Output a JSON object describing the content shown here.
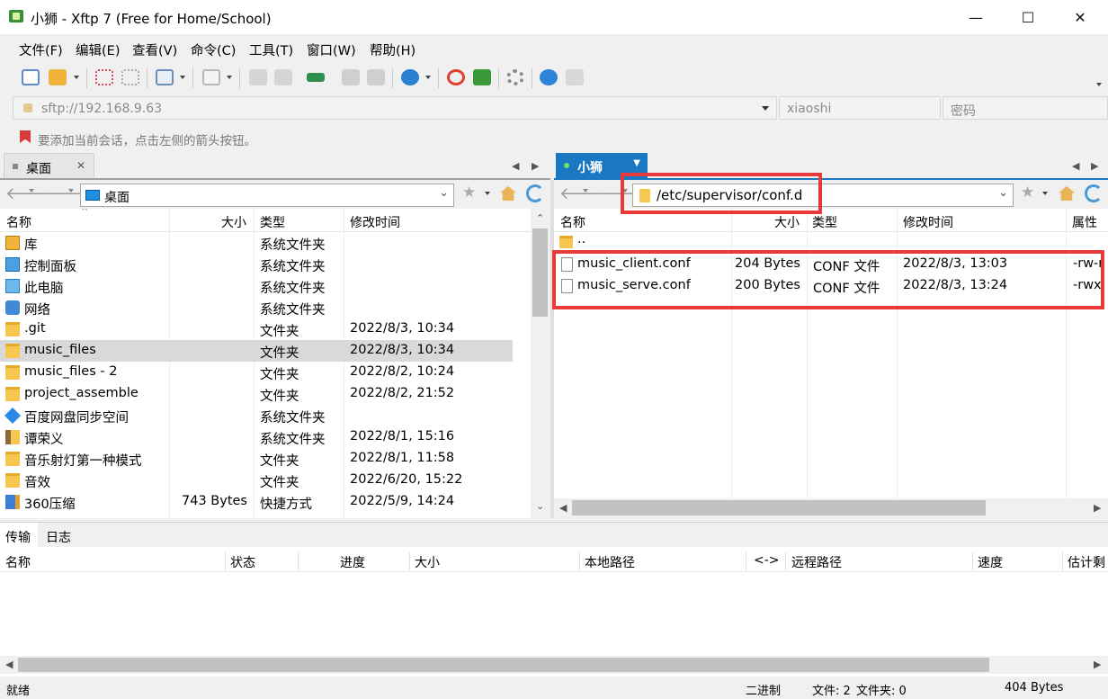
{
  "window": {
    "title": "小狮 - Xftp 7 (Free for Home/School)",
    "min_glyph": "—",
    "max_glyph": "☐",
    "close_glyph": "✕"
  },
  "menu": [
    "文件(F)",
    "编辑(E)",
    "查看(V)",
    "命令(C)",
    "工具(T)",
    "窗口(W)",
    "帮助(H)"
  ],
  "address": {
    "url": "sftp://192.168.9.63",
    "username": "xiaoshi",
    "password_placeholder": "密码"
  },
  "hint": "要添加当前会话，点击左侧的箭头按钮。",
  "left_pane": {
    "tab_label": "桌面",
    "path": "桌面",
    "columns": [
      "名称",
      "大小",
      "类型",
      "修改时间"
    ],
    "rows": [
      {
        "name": "库",
        "size": "",
        "type": "系统文件夹",
        "modified": "",
        "icon": "library-icon"
      },
      {
        "name": "控制面板",
        "size": "",
        "type": "系统文件夹",
        "modified": "",
        "icon": "control-panel-icon"
      },
      {
        "name": "此电脑",
        "size": "",
        "type": "系统文件夹",
        "modified": "",
        "icon": "computer-icon"
      },
      {
        "name": "网络",
        "size": "",
        "type": "系统文件夹",
        "modified": "",
        "icon": "network-icon"
      },
      {
        "name": ".git",
        "size": "",
        "type": "文件夹",
        "modified": "2022/8/3, 10:34",
        "icon": "folder-icon"
      },
      {
        "name": "music_files",
        "size": "",
        "type": "文件夹",
        "modified": "2022/8/3, 10:34",
        "icon": "folder-icon",
        "selected": true
      },
      {
        "name": "music_files - 2",
        "size": "",
        "type": "文件夹",
        "modified": "2022/8/2, 10:24",
        "icon": "folder-icon"
      },
      {
        "name": "project_assemble",
        "size": "",
        "type": "文件夹",
        "modified": "2022/8/2, 21:52",
        "icon": "folder-icon"
      },
      {
        "name": "百度网盘同步空间",
        "size": "",
        "type": "系统文件夹",
        "modified": "",
        "icon": "baidu-sync-icon"
      },
      {
        "name": "谭荣义",
        "size": "",
        "type": "系统文件夹",
        "modified": "2022/8/1, 15:16",
        "icon": "user-folder-icon"
      },
      {
        "name": "音乐射灯第一种模式",
        "size": "",
        "type": "文件夹",
        "modified": "2022/8/1, 11:58",
        "icon": "folder-icon"
      },
      {
        "name": "音效",
        "size": "",
        "type": "文件夹",
        "modified": "2022/6/20, 15:22",
        "icon": "folder-icon"
      },
      {
        "name": "360压缩",
        "size": "743 Bytes",
        "type": "快捷方式",
        "modified": "2022/5/9, 14:24",
        "icon": "shortcut-icon"
      }
    ]
  },
  "right_pane": {
    "tab_label": "小狮",
    "path": "/etc/supervisor/conf.d",
    "columns": [
      "名称",
      "大小",
      "类型",
      "修改时间",
      "属性"
    ],
    "parent_row": "..",
    "rows": [
      {
        "name": "music_client.conf",
        "size": "204 Bytes",
        "type": "CONF 文件",
        "modified": "2022/8/3, 13:03",
        "attr": "-rw-r"
      },
      {
        "name": "music_serve.conf",
        "size": "200 Bytes",
        "type": "CONF 文件",
        "modified": "2022/8/3, 13:24",
        "attr": "-rwx"
      }
    ]
  },
  "transfer": {
    "tabs": [
      "传输",
      "日志"
    ],
    "columns": [
      "名称",
      "状态",
      "进度",
      "大小",
      "本地路径",
      "<->",
      "远程路径",
      "速度",
      "估计剩"
    ]
  },
  "status": {
    "ready": "就绪",
    "mode": "二进制",
    "files": "文件: 2",
    "folders": "文件夹: 0",
    "size": "404 Bytes"
  },
  "colors": {
    "accent": "#1a78c2",
    "selected_row": "#d9d9d9",
    "annotation_red": "#e83a3a"
  }
}
